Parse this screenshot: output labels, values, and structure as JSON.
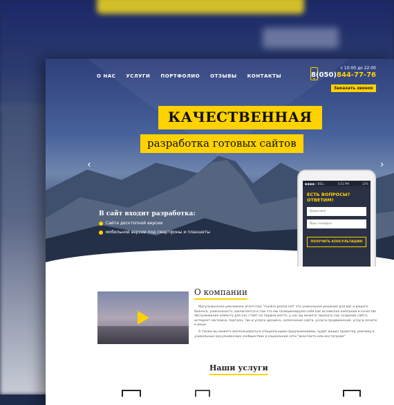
{
  "nav": [
    "О НАС",
    "УСЛУГИ",
    "ПОРТФОЛИО",
    "ОТЗЫВЫ",
    "КОНТАКТЫ"
  ],
  "contact": {
    "hours": "с 10:00 до 22:00",
    "phone_prefix": "8(050)",
    "phone_number": "844-77-76",
    "callback": "Заказать звонок"
  },
  "hero": {
    "title1": "КАЧЕСТВЕННАЯ",
    "title2": "разработка готовых сайтов",
    "dev_title": "В сайт входит разработка:",
    "dev_items": [
      "Сайта десктопной версии",
      "мобильной версии под смартфоны и планшеты"
    ]
  },
  "phone_form": {
    "status_left": "●●●●○ BELL",
    "status_time": "4:21 PM",
    "status_right": "22%",
    "question": "ЕСТЬ ВОПРОСЫ?",
    "answer": "ОТВЕТИМ!",
    "name_placeholder": "Ваше имя",
    "phone_placeholder": "Ваш телефон",
    "button": "ПОЛУЧИТЬ КОНСУЛЬТАЦИЮ"
  },
  "about": {
    "title": "О компании",
    "p1": "Мусульманское рекламное агентство \"muslim-promo.net\" это уникальное решение для вас и вашего бизнеса, уникальность заключается в том что мы позиционируем себя как исламская компания и качество обслуживания клиента для нас стоит на первом месте, у нас вы можете заказать как создание сайта, интернет магазина, портала, так и услуги дизайна, наполнения сайта, услуги продвижения, услуги печати и иные.",
    "p2": "А также вы можете воспользоваться специальными предложениями, аудит ваших проектов, рекламу в уникальных мусульманских сообществах в социальной сети \"вконтакте или инстаграме\""
  },
  "services": {
    "title": "Наши услуги"
  },
  "colors": {
    "accent": "#ffd200",
    "hero_dark": "#2f3f7a"
  }
}
